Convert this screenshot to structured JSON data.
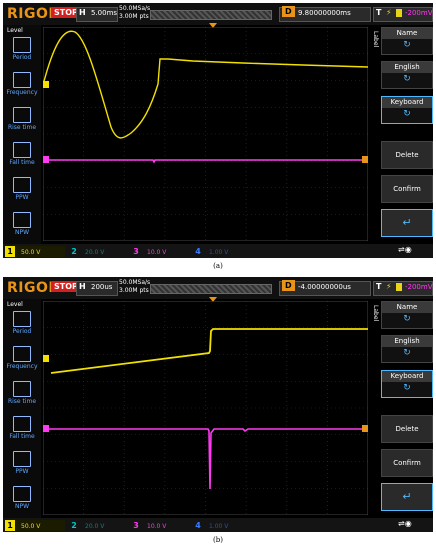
{
  "panels": [
    {
      "caption": "(a)",
      "logo": "RIGOL",
      "run_state": "STOP",
      "timebase_label": "H",
      "timebase": "5.00ms",
      "sample_rate": "50.0MSa/s",
      "memory_depth": "3.00M pts",
      "delay_label": "D",
      "delay": "9.80000000ms",
      "trigger_label": "T",
      "trigger_level": "-200mV",
      "left_title": "Level",
      "measures": [
        "Period",
        "Frequency",
        "Rise time",
        "Fall time",
        "PPW",
        "NPW"
      ],
      "side_tab": "Label",
      "right_buttons": {
        "name": "Name",
        "english": "English",
        "keyboard": "Keyboard",
        "delete": "Delete",
        "confirm": "Confirm"
      },
      "channels": [
        {
          "num": "1",
          "scale": "50.0 V",
          "color": "#f2e000"
        },
        {
          "num": "2",
          "scale": "20.0 V",
          "color": "#00c8c8"
        },
        {
          "num": "3",
          "scale": "10.0 V",
          "color": "#ff3af0"
        },
        {
          "num": "4",
          "scale": "1.00 V",
          "color": "#3a7bff"
        }
      ]
    },
    {
      "caption": "(b)",
      "logo": "RIGOL",
      "run_state": "STOP",
      "timebase_label": "H",
      "timebase": "200us",
      "sample_rate": "50.0MSa/s",
      "memory_depth": "3.00M pts",
      "delay_label": "D",
      "delay": "-4.00000000us",
      "trigger_label": "T",
      "trigger_level": "-200mV",
      "left_title": "Level",
      "measures": [
        "Period",
        "Frequency",
        "Rise time",
        "Fall time",
        "PPW",
        "NPW"
      ],
      "side_tab": "Label",
      "right_buttons": {
        "name": "Name",
        "english": "English",
        "keyboard": "Keyboard",
        "delete": "Delete",
        "confirm": "Confirm"
      },
      "channels": [
        {
          "num": "1",
          "scale": "50.0 V",
          "color": "#f2e000"
        },
        {
          "num": "2",
          "scale": "20.0 V",
          "color": "#00c8c8"
        },
        {
          "num": "3",
          "scale": "10.0 V",
          "color": "#ff3af0"
        },
        {
          "num": "4",
          "scale": "1.00 V",
          "color": "#3a7bff"
        }
      ]
    }
  ],
  "icons": {
    "refresh": "refresh-icon",
    "enter": "enter-icon",
    "usb": "usb-icon"
  }
}
